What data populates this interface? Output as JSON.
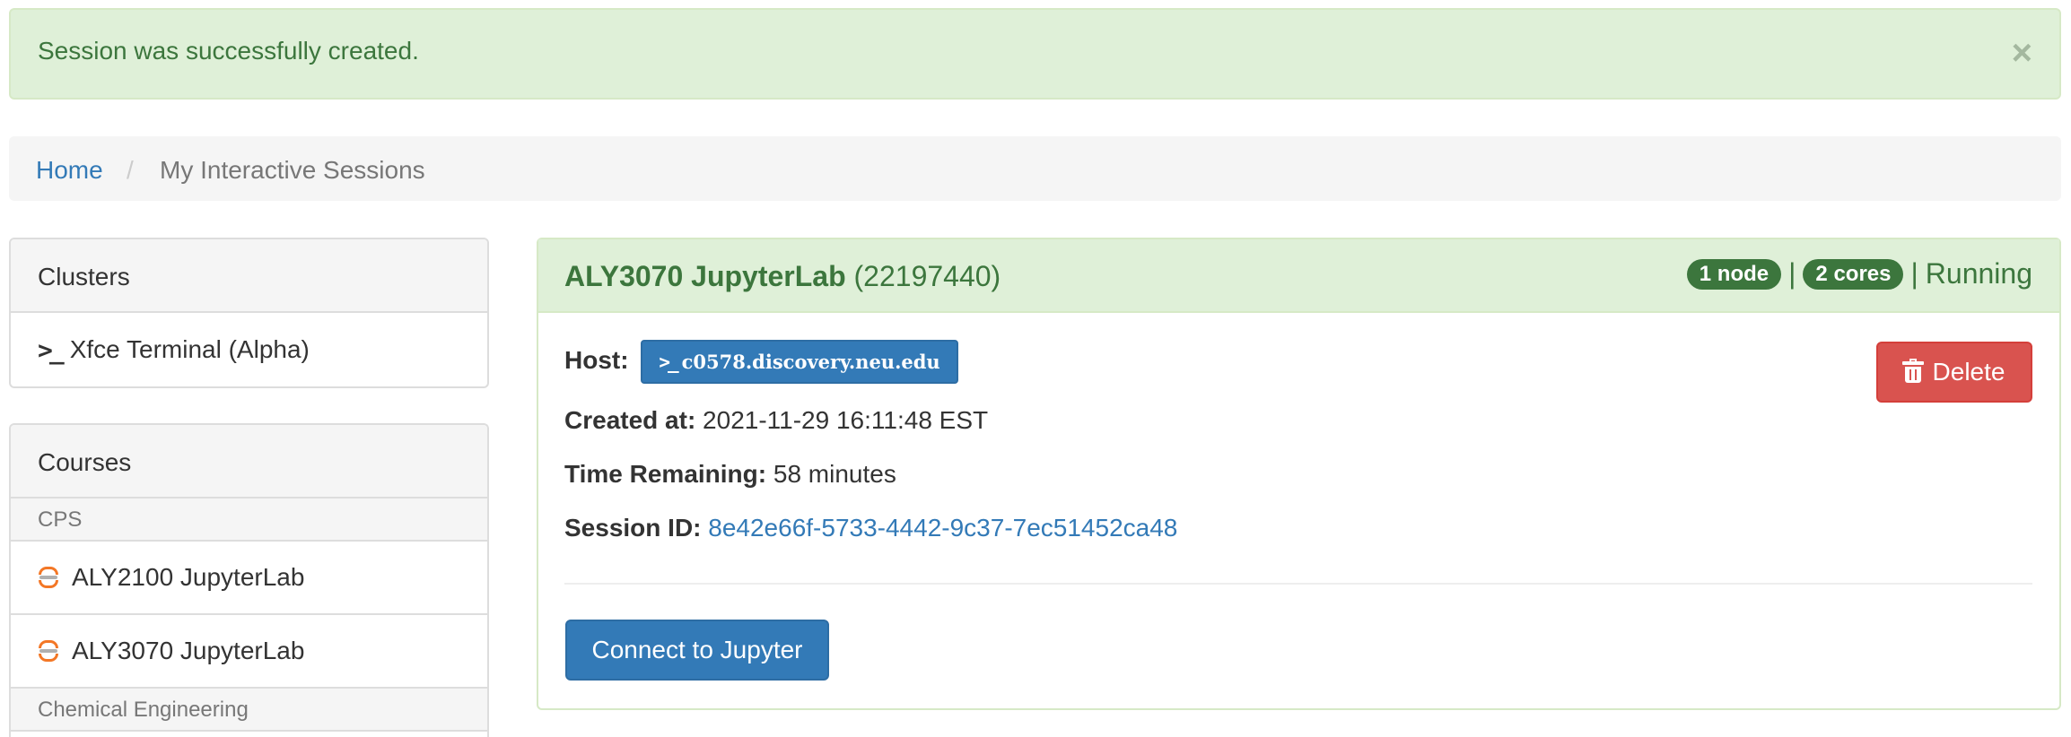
{
  "alert": {
    "message": "Session was successfully created.",
    "close": "×",
    "color": "#3c763d"
  },
  "breadcrumb": {
    "home": "Home",
    "separator": "/",
    "current": "My Interactive Sessions"
  },
  "clusters": {
    "heading": "Clusters",
    "items": [
      {
        "icon": "terminal-icon",
        "label": "Xfce Terminal (Alpha)"
      }
    ]
  },
  "courses": {
    "heading": "Courses",
    "categories": [
      {
        "name": "CPS",
        "items": [
          {
            "icon": "jupyter-icon",
            "label": "ALY2100 JupyterLab"
          },
          {
            "icon": "jupyter-icon",
            "label": "ALY3070 JupyterLab"
          }
        ]
      },
      {
        "name": "Chemical Engineering",
        "items": []
      }
    ]
  },
  "session": {
    "name": "ALY3070 JupyterLab",
    "job_id": "(22197440)",
    "nodes_badge": "1 node",
    "cores_badge": "2 cores",
    "separator": "|",
    "status": "Running",
    "host_label": "Host:",
    "host_value": "c0578.discovery.neu.edu",
    "created_label": "Created at:",
    "created_value": "2021-11-29 16:11:48 EST",
    "remaining_label": "Time Remaining:",
    "remaining_value": "58 minutes",
    "session_id_label": "Session ID:",
    "session_id_value": "8e42e66f-5733-4442-9c37-7ec51452ca48",
    "delete_label": "Delete",
    "connect_label": "Connect to Jupyter"
  },
  "colors": {
    "success_bg": "#dff0d8",
    "success_text": "#3c763d",
    "primary": "#337ab7",
    "danger": "#d9534f"
  }
}
